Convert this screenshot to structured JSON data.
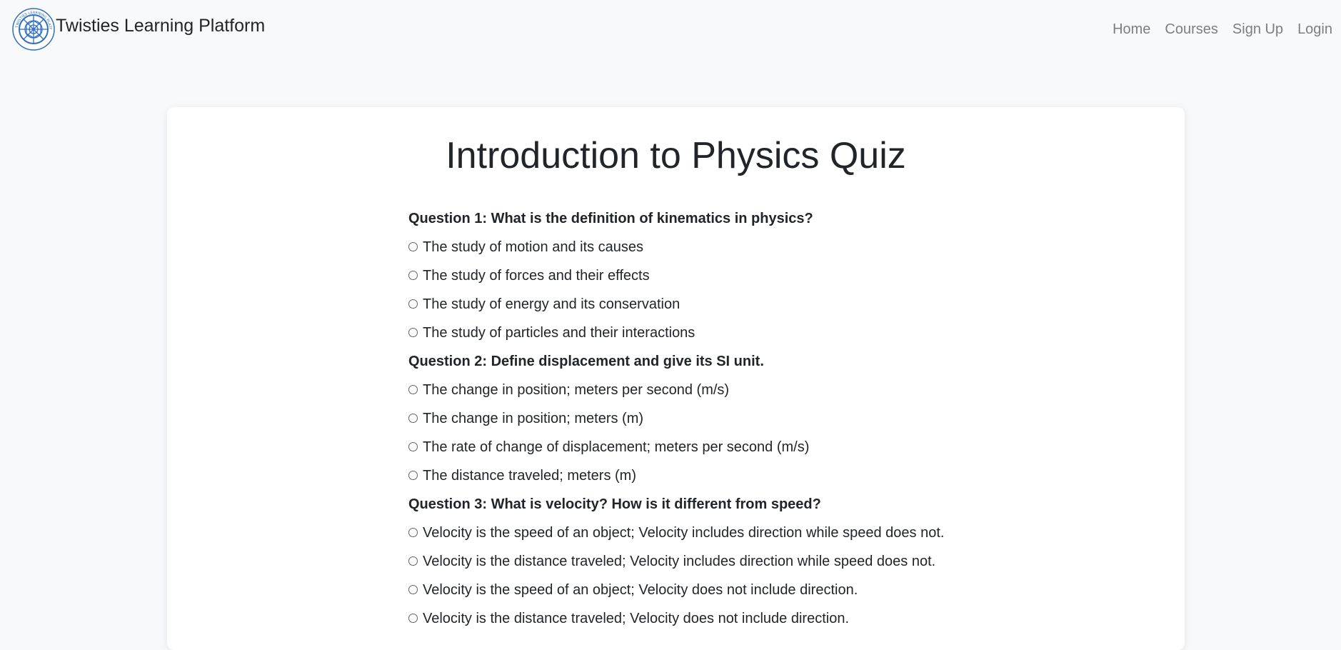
{
  "brand": {
    "name": "Twisties Learning Platform",
    "logo_ring_text": "TWISTIES LEARNING PLATFORM",
    "logo_accent": "#2f6fbf"
  },
  "nav": {
    "items": [
      {
        "label": "Home"
      },
      {
        "label": "Courses"
      },
      {
        "label": "Sign Up"
      },
      {
        "label": "Login"
      }
    ]
  },
  "quiz": {
    "title": "Introduction to Physics Quiz",
    "questions": [
      {
        "text": "Question 1: What is the definition of kinematics in physics?",
        "options": [
          "The study of motion and its causes",
          "The study of forces and their effects",
          "The study of energy and its conservation",
          "The study of particles and their interactions"
        ]
      },
      {
        "text": "Question 2: Define displacement and give its SI unit.",
        "options": [
          "The change in position; meters per second (m/s)",
          "The change in position; meters (m)",
          "The rate of change of displacement; meters per second (m/s)",
          "The distance traveled; meters (m)"
        ]
      },
      {
        "text": "Question 3: What is velocity? How is it different from speed?",
        "options": [
          "Velocity is the speed of an object; Velocity includes direction while speed does not.",
          "Velocity is the distance traveled; Velocity includes direction while speed does not.",
          "Velocity is the speed of an object; Velocity does not include direction.",
          "Velocity is the distance traveled; Velocity does not include direction."
        ]
      }
    ]
  }
}
